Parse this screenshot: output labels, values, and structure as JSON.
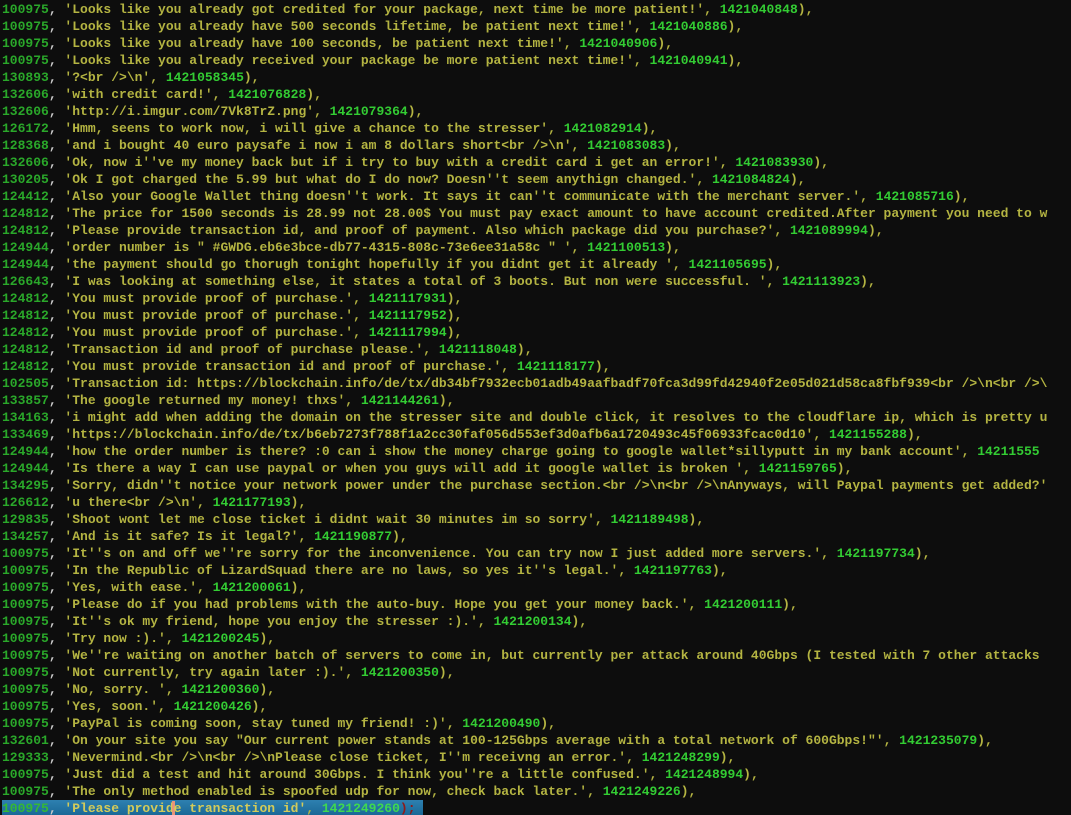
{
  "terminal": {
    "background": "#0d0d0d",
    "separator": ", ",
    "colors": {
      "record_id": "#2aa82a",
      "field_comma": "#c9c9c9",
      "string": "#b4b442",
      "timestamp": "#33cc33",
      "statement_terminator": "#8f1a1a",
      "highlight_bar": "#2278a8",
      "cursor": "#e8947a"
    },
    "rows": [
      {
        "id": "100975",
        "str": "'Looks like you already got credited for your package, next time be more patient!'",
        "ts": "1421040848",
        "end": "),"
      },
      {
        "id": "100975",
        "str": "'Looks like you already have 500 seconds lifetime, be patient next time!'",
        "ts": "1421040886",
        "end": "),"
      },
      {
        "id": "100975",
        "str": "'Looks like you already have 100 seconds, be patient next time!'",
        "ts": "1421040906",
        "end": "),"
      },
      {
        "id": "100975",
        "str": "'Looks like you already received your package be more patient next time!'",
        "ts": "1421040941",
        "end": "),"
      },
      {
        "id": "130893",
        "str": "'?<br />\\n'",
        "ts": "1421058345",
        "end": "),"
      },
      {
        "id": "132606",
        "str": "'with credit card!'",
        "ts": "1421076828",
        "end": "),"
      },
      {
        "id": "132606",
        "str": "'http://i.imgur.com/7Vk8TrZ.png'",
        "ts": "1421079364",
        "end": "),"
      },
      {
        "id": "126172",
        "str": "'Hmm, seens to work now, i will give a chance to the stresser'",
        "ts": "1421082914",
        "end": "),"
      },
      {
        "id": "128368",
        "str": "'and i bought 40 euro paysafe i now i am 8 dollars short<br />\\n'",
        "ts": "1421083083",
        "end": "),"
      },
      {
        "id": "132606",
        "str": "'Ok, now i''ve my money back but if i try to buy with a credit card i get an error!'",
        "ts": "1421083930",
        "end": "),"
      },
      {
        "id": "130205",
        "str": "'Ok I got charged the 5.99 but what do I do now? Doesn''t seem anythign changed.'",
        "ts": "1421084824",
        "end": "),"
      },
      {
        "id": "124412",
        "str": "'Also your Google Wallet thing doesn''t work. It says it can''t communicate with the merchant server.'",
        "ts": "1421085716",
        "end": "),"
      },
      {
        "id": "124812",
        "str": "'The price for 1500 seconds is 28.99 not 28.00$ You must pay exact amount to have account credited.After payment you need to w",
        "ts": "",
        "end": ""
      },
      {
        "id": "124812",
        "str": "'Please provide transaction id, and proof of payment. Also which package did you purchase?'",
        "ts": "1421089994",
        "end": "),"
      },
      {
        "id": "124944",
        "str": "'order number is \" #GWDG.eb6e3bce-db77-4315-808c-73e6ee31a58c \" '",
        "ts": "1421100513",
        "end": "),"
      },
      {
        "id": "124944",
        "str": "'the payment should go thorugh tonight hopefully if you didnt get it already '",
        "ts": "1421105695",
        "end": "),"
      },
      {
        "id": "126643",
        "str": "'I was looking at something else, it states a total of 3 boots. But non were successful. '",
        "ts": "1421113923",
        "end": "),"
      },
      {
        "id": "124812",
        "str": "'You must provide proof of purchase.'",
        "ts": "1421117931",
        "end": "),"
      },
      {
        "id": "124812",
        "str": "'You must provide proof of purchase.'",
        "ts": "1421117952",
        "end": "),"
      },
      {
        "id": "124812",
        "str": "'You must provide proof of purchase.'",
        "ts": "1421117994",
        "end": "),"
      },
      {
        "id": "124812",
        "str": "'Transaction id and proof of purchase please.'",
        "ts": "1421118048",
        "end": "),"
      },
      {
        "id": "124812",
        "str": "'You must provide transaction id and proof of purchase.'",
        "ts": "1421118177",
        "end": "),"
      },
      {
        "id": "102505",
        "str": "'Transaction id: https://blockchain.info/de/tx/db34bf7932ecb01adb49aafbadf70fca3d99fd42940f2e05d021d58ca8fbf939<br />\\n<br />\\",
        "ts": "",
        "end": ""
      },
      {
        "id": "133857",
        "str": "'The google returned my money! thxs'",
        "ts": "1421144261",
        "end": "),"
      },
      {
        "id": "134163",
        "str": "'i might add when adding the domain on the stresser site and double click, it resolves to the cloudflare ip, which is pretty u",
        "ts": "",
        "end": ""
      },
      {
        "id": "133469",
        "str": "'https://blockchain.info/de/tx/b6eb7273f788f1a2cc30faf056d553ef3d0afb6a1720493c45f06933fcac0d10'",
        "ts": "1421155288",
        "end": "),"
      },
      {
        "id": "124944",
        "str": "'how the order number is there? :0 can i show the money charge going to google wallet*sillyputt in my bank account'",
        "ts": "14211555",
        "end": ""
      },
      {
        "id": "124944",
        "str": "'Is there a way I can use paypal or when you guys will add it google wallet is broken '",
        "ts": "1421159765",
        "end": "),"
      },
      {
        "id": "134295",
        "str": "'Sorry, didn''t notice your network power under the purchase section.<br />\\n<br />\\nAnyways, will Paypal payments get added?'",
        "ts": "",
        "end": ""
      },
      {
        "id": "126612",
        "str": "'u there<br />\\n'",
        "ts": "1421177193",
        "end": "),"
      },
      {
        "id": "129835",
        "str": "'Shoot wont let me close ticket i didnt wait 30 minutes im so sorry'",
        "ts": "1421189498",
        "end": "),"
      },
      {
        "id": "134257",
        "str": "'And is it safe? Is it legal?'",
        "ts": "1421190877",
        "end": "),"
      },
      {
        "id": "100975",
        "str": "'It''s on and off we''re sorry for the inconvenience. You can try now I just added more servers.'",
        "ts": "1421197734",
        "end": "),"
      },
      {
        "id": "100975",
        "str": "'In the Republic of LizardSquad there are no laws, so yes it''s legal.'",
        "ts": "1421197763",
        "end": "),"
      },
      {
        "id": "100975",
        "str": "'Yes, with ease.'",
        "ts": "1421200061",
        "end": "),"
      },
      {
        "id": "100975",
        "str": "'Please do if you had problems with the auto-buy. Hope you get your money back.'",
        "ts": "1421200111",
        "end": "),"
      },
      {
        "id": "100975",
        "str": "'It''s ok my friend, hope you enjoy the stresser :).'",
        "ts": "1421200134",
        "end": "),"
      },
      {
        "id": "100975",
        "str": "'Try now :).'",
        "ts": "1421200245",
        "end": "),"
      },
      {
        "id": "100975",
        "str": "'We''re waiting on another batch of servers to come in, but currently per attack around 40Gbps (I tested with 7 other attacks",
        "ts": "",
        "end": ""
      },
      {
        "id": "100975",
        "str": "'Not currently, try again later :).'",
        "ts": "1421200350",
        "end": "),"
      },
      {
        "id": "100975",
        "str": "'No, sorry. '",
        "ts": "1421200360",
        "end": "),"
      },
      {
        "id": "100975",
        "str": "'Yes, soon.'",
        "ts": "1421200426",
        "end": "),"
      },
      {
        "id": "100975",
        "str": "'PayPal is coming soon, stay tuned my friend! :)'",
        "ts": "1421200490",
        "end": "),"
      },
      {
        "id": "132601",
        "str": "'On your site you say \"Our current power stands at 100-125Gbps average with a total network of 600Gbps!\"'",
        "ts": "1421235079",
        "end": "),"
      },
      {
        "id": "129333",
        "str": "'Nevermind.<br />\\n<br />\\nPlease close ticket, I''m receivng an error.'",
        "ts": "1421248299",
        "end": "),"
      },
      {
        "id": "100975",
        "str": "'Just did a test and hit around 30Gbps. I think you''re a little confused.'",
        "ts": "1421248994",
        "end": "),"
      },
      {
        "id": "100975",
        "str": "'The only method enabled is spoofed udp for now, check back later.'",
        "ts": "1421249226",
        "end": "),"
      },
      {
        "id": "100975",
        "pre": "'Please provid",
        "post": "e transaction id'",
        "ts": "1421249260",
        "end": ");",
        "highlight": true
      }
    ]
  }
}
